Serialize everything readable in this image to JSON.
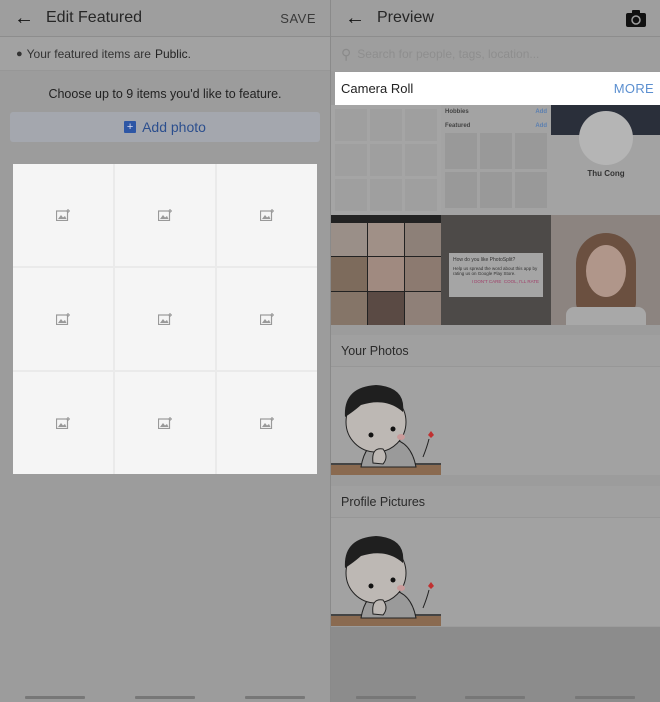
{
  "left": {
    "header": {
      "back_icon": "arrow-left-icon",
      "title": "Edit Featured",
      "save_label": "SAVE"
    },
    "privacy": {
      "icon": "globe-icon",
      "text": "Your featured items are",
      "value": "Public",
      "suffix": "."
    },
    "instruction": "Choose up to 9 items you'd like to feature.",
    "add_photo": {
      "icon": "add-photo-icon",
      "label": "Add photo"
    },
    "grid_slots": 9
  },
  "right": {
    "header": {
      "back_icon": "arrow-left-icon",
      "title": "Preview",
      "camera_icon": "camera-icon"
    },
    "search": {
      "placeholder": "Search for people, tags, location..."
    },
    "camera_roll": {
      "title": "Camera Roll",
      "more_label": "MORE"
    },
    "thumb_profile": {
      "hobbies": "Hobbies",
      "featured": "Featured",
      "add": "Add",
      "name": "Thu Cong"
    },
    "thumb_dialog": {
      "title": "How do you like PhotoSplit?",
      "body": "Help us spread the word about this app by rating us on Google Play Store.",
      "btn1": "I DON'T CARE",
      "btn2": "COOL, I'LL RATE"
    },
    "sections": [
      {
        "title": "Your Photos"
      },
      {
        "title": "Profile Pictures"
      }
    ]
  },
  "colors": {
    "accent": "#5b8fd0",
    "add_photo_text": "#2c4f8e"
  }
}
